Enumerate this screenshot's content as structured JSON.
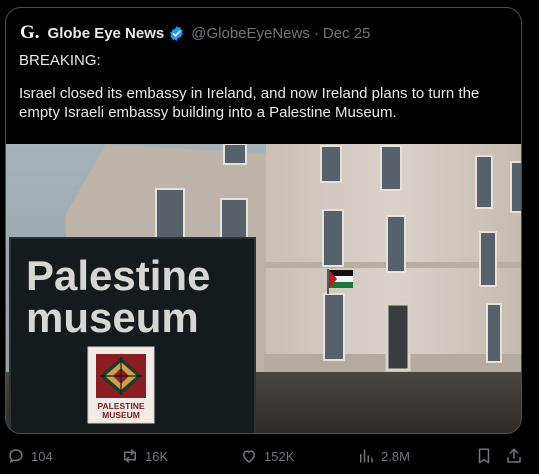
{
  "tweet": {
    "logo_text": "G.",
    "author_name": "Globe Eye News",
    "handle": "@GlobeEyeNews",
    "separator": "·",
    "date": "Dec 25",
    "text_line_1": "BREAKING:",
    "text_line_2": "Israel closed its embassy in Ireland, and now Ireland plans to turn the empty Israeli embassy building into a Palestine Museum."
  },
  "media": {
    "sign_title_line_1": "Palestine",
    "sign_title_line_2": "museum",
    "badge_line_1": "PALESTINE",
    "badge_line_2": "MUSEUM"
  },
  "actions": {
    "replies": "104",
    "reposts": "16K",
    "likes": "152K",
    "views": "2.8M"
  },
  "colors": {
    "verified_badge": "#1d9bf0",
    "muted_text": "#71767b",
    "main_text": "#e7e9ea"
  }
}
